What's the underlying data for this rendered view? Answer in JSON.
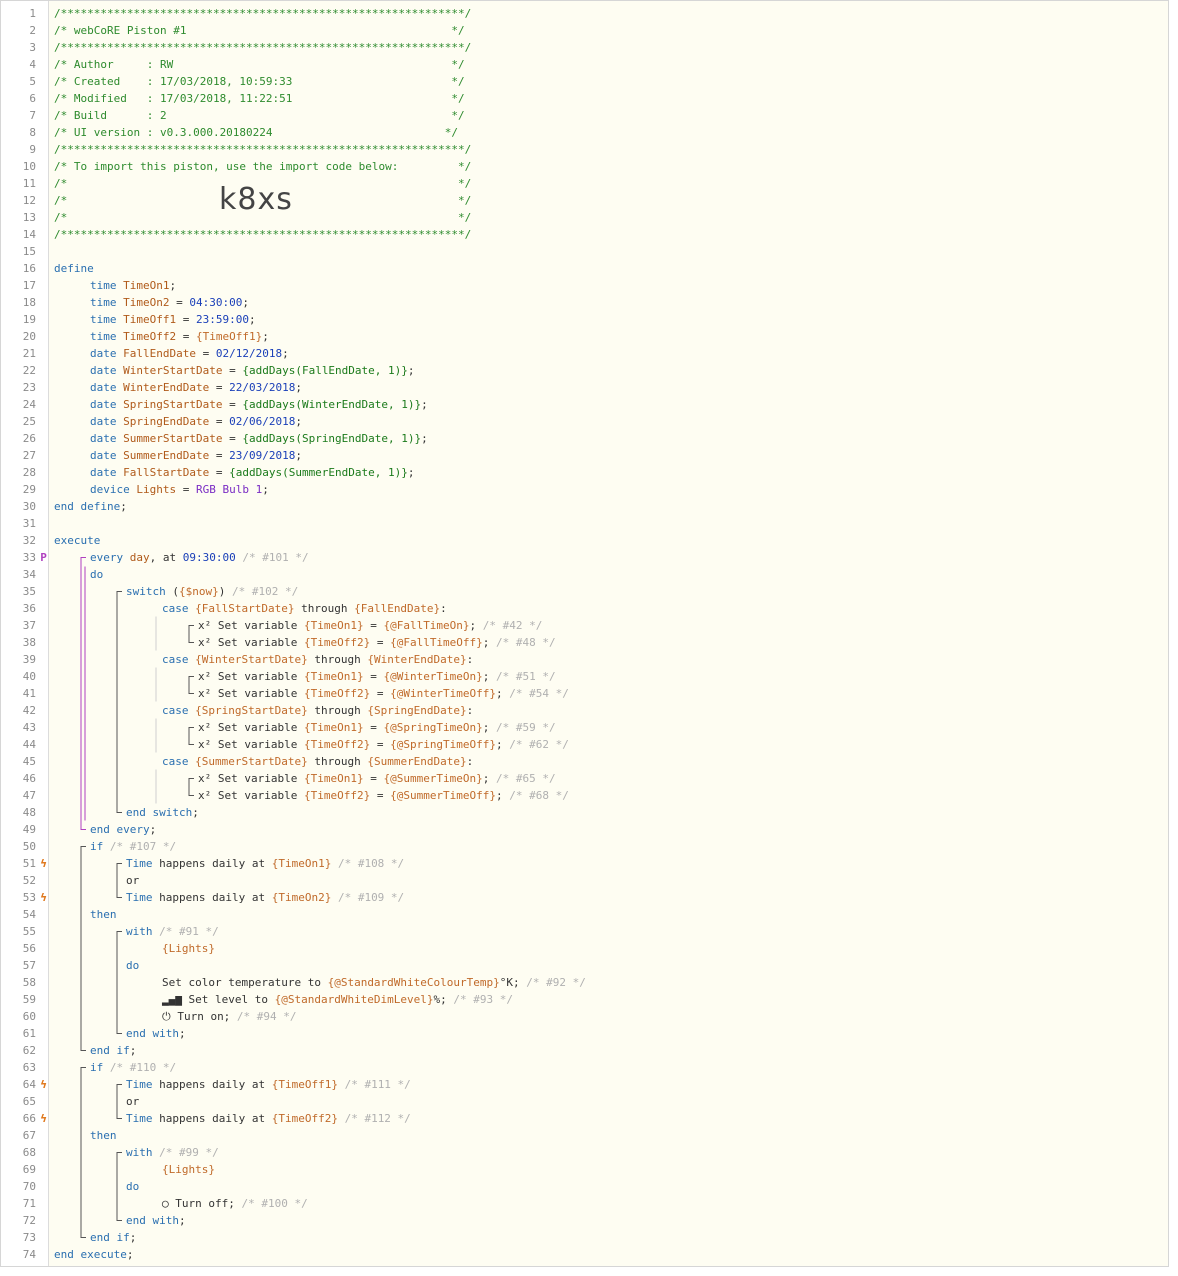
{
  "header": {
    "line_bar": "/*************************************************************/",
    "title_line": "/* webCoRE Piston #1                                        */",
    "author_line": "/* Author     : RW                                          */",
    "created_line": "/* Created    : 17/03/2018, 10:59:33                        */",
    "modified_line": "/* Modified   : 17/03/2018, 11:22:51                        */",
    "build_line": "/* Build      : 2                                           */",
    "ui_line": "/* UI version : v0.3.000.20180224                          */",
    "import_line": "/* To import this piston, use the import code below:         */",
    "blank_line": "/*                                                           */",
    "import_code": "k8xs"
  },
  "code_lines": [
    {
      "n": 1,
      "t": [
        [
          "c",
          "/*************************************************************/"
        ]
      ]
    },
    {
      "n": 2,
      "t": [
        [
          "c2",
          "/* webCoRE Piston #1                                        */"
        ]
      ]
    },
    {
      "n": 3,
      "t": [
        [
          "c",
          "/*************************************************************/"
        ]
      ]
    },
    {
      "n": 4,
      "t": [
        [
          "c2",
          "/* Author     : RW                                          */"
        ]
      ]
    },
    {
      "n": 5,
      "t": [
        [
          "c2",
          "/* Created    : 17/03/2018, 10:59:33                        */"
        ]
      ]
    },
    {
      "n": 6,
      "t": [
        [
          "c2",
          "/* Modified   : 17/03/2018, 11:22:51                        */"
        ]
      ]
    },
    {
      "n": 7,
      "t": [
        [
          "c2",
          "/* Build      : 2                                           */"
        ]
      ]
    },
    {
      "n": 8,
      "t": [
        [
          "c2",
          "/* UI version : v0.3.000.20180224                          */"
        ]
      ]
    },
    {
      "n": 9,
      "t": [
        [
          "c",
          "/*************************************************************/"
        ]
      ]
    },
    {
      "n": 10,
      "t": [
        [
          "c2",
          "/* To import this piston, use the import code below:         */"
        ]
      ]
    },
    {
      "n": 11,
      "t": [
        [
          "c2",
          "/*                                                           */"
        ]
      ]
    },
    {
      "n": 12,
      "t": [
        [
          "c2",
          "/*                                                           */"
        ]
      ],
      "big": true
    },
    {
      "n": 13,
      "t": [
        [
          "c2",
          "/*                                                           */"
        ]
      ]
    },
    {
      "n": 14,
      "t": [
        [
          "c",
          "/*************************************************************/"
        ]
      ]
    },
    {
      "n": 15,
      "t": []
    },
    {
      "n": 16,
      "t": [
        [
          "k",
          "define"
        ]
      ]
    },
    {
      "n": 17,
      "i": 1,
      "t": [
        [
          "ty",
          "time "
        ],
        [
          "nm",
          "TimeOn1"
        ],
        [
          "o",
          ";"
        ]
      ]
    },
    {
      "n": 18,
      "i": 1,
      "t": [
        [
          "ty",
          "time "
        ],
        [
          "nm",
          "TimeOn2"
        ],
        [
          "o",
          " = "
        ],
        [
          "n",
          "04:30:00"
        ],
        [
          "o",
          ";"
        ]
      ]
    },
    {
      "n": 19,
      "i": 1,
      "t": [
        [
          "ty",
          "time "
        ],
        [
          "nm",
          "TimeOff1"
        ],
        [
          "o",
          " = "
        ],
        [
          "n",
          "23:59:00"
        ],
        [
          "o",
          ";"
        ]
      ]
    },
    {
      "n": 20,
      "i": 1,
      "t": [
        [
          "ty",
          "time "
        ],
        [
          "nm",
          "TimeOff2"
        ],
        [
          "o",
          " = "
        ],
        [
          "v",
          "{TimeOff1}"
        ],
        [
          "o",
          ";"
        ]
      ]
    },
    {
      "n": 21,
      "i": 1,
      "t": [
        [
          "ty",
          "date "
        ],
        [
          "nm",
          "FallEndDate"
        ],
        [
          "o",
          " = "
        ],
        [
          "n",
          "02/12/2018"
        ],
        [
          "o",
          ";"
        ]
      ]
    },
    {
      "n": 22,
      "i": 1,
      "t": [
        [
          "ty",
          "date "
        ],
        [
          "nm",
          "WinterStartDate"
        ],
        [
          "o",
          " = "
        ],
        [
          "p",
          "{addDays(FallEndDate, 1)}"
        ],
        [
          "o",
          ";"
        ]
      ]
    },
    {
      "n": 23,
      "i": 1,
      "t": [
        [
          "ty",
          "date "
        ],
        [
          "nm",
          "WinterEndDate"
        ],
        [
          "o",
          " = "
        ],
        [
          "n",
          "22/03/2018"
        ],
        [
          "o",
          ";"
        ]
      ]
    },
    {
      "n": 24,
      "i": 1,
      "t": [
        [
          "ty",
          "date "
        ],
        [
          "nm",
          "SpringStartDate"
        ],
        [
          "o",
          " = "
        ],
        [
          "p",
          "{addDays(WinterEndDate, 1)}"
        ],
        [
          "o",
          ";"
        ]
      ]
    },
    {
      "n": 25,
      "i": 1,
      "t": [
        [
          "ty",
          "date "
        ],
        [
          "nm",
          "SpringEndDate"
        ],
        [
          "o",
          " = "
        ],
        [
          "n",
          "02/06/2018"
        ],
        [
          "o",
          ";"
        ]
      ]
    },
    {
      "n": 26,
      "i": 1,
      "t": [
        [
          "ty",
          "date "
        ],
        [
          "nm",
          "SummerStartDate"
        ],
        [
          "o",
          " = "
        ],
        [
          "p",
          "{addDays(SpringEndDate, 1)}"
        ],
        [
          "o",
          ";"
        ]
      ]
    },
    {
      "n": 27,
      "i": 1,
      "t": [
        [
          "ty",
          "date "
        ],
        [
          "nm",
          "SummerEndDate"
        ],
        [
          "o",
          " = "
        ],
        [
          "n",
          "23/09/2018"
        ],
        [
          "o",
          ";"
        ]
      ]
    },
    {
      "n": 28,
      "i": 1,
      "t": [
        [
          "ty",
          "date "
        ],
        [
          "nm",
          "FallStartDate"
        ],
        [
          "o",
          " = "
        ],
        [
          "p",
          "{addDays(SummerEndDate, 1)}"
        ],
        [
          "o",
          ";"
        ]
      ]
    },
    {
      "n": 29,
      "i": 1,
      "t": [
        [
          "ty",
          "device "
        ],
        [
          "nm",
          "Lights"
        ],
        [
          "o",
          " = "
        ],
        [
          "d",
          "RGB Bulb 1"
        ],
        [
          "o",
          ";"
        ]
      ]
    },
    {
      "n": 30,
      "t": [
        [
          "k",
          "end define"
        ],
        [
          "o",
          ";"
        ]
      ]
    },
    {
      "n": 31,
      "t": []
    },
    {
      "n": 32,
      "t": [
        [
          "k",
          "execute"
        ]
      ]
    },
    {
      "n": 33,
      "i": 1,
      "m": "p",
      "t": [
        [
          "k",
          "every "
        ],
        [
          "nm",
          "day"
        ],
        [
          "o",
          ", at "
        ],
        [
          "n",
          "09:30:00"
        ],
        [
          "cm",
          " /* #101 */"
        ]
      ]
    },
    {
      "n": 34,
      "i": 1,
      "t": [
        [
          "k",
          "do"
        ]
      ]
    },
    {
      "n": 35,
      "i": 2,
      "t": [
        [
          "k",
          "switch "
        ],
        [
          "o",
          "("
        ],
        [
          "v",
          "{$now}"
        ],
        [
          "o",
          ")"
        ],
        [
          "cm",
          " /* #102 */"
        ]
      ]
    },
    {
      "n": 36,
      "i": 3,
      "t": [
        [
          "k",
          "case "
        ],
        [
          "v",
          "{FallStartDate}"
        ],
        [
          "o",
          " through "
        ],
        [
          "v",
          "{FallEndDate}"
        ],
        [
          "o",
          ":"
        ]
      ]
    },
    {
      "n": 37,
      "i": 4,
      "t": [
        [
          "i",
          "x² "
        ],
        [
          "o",
          "Set variable "
        ],
        [
          "v",
          "{TimeOn1}"
        ],
        [
          "o",
          " = "
        ],
        [
          "v",
          "{@FallTimeOn}"
        ],
        [
          "o",
          ";"
        ],
        [
          "cm",
          " /* #42 */"
        ]
      ]
    },
    {
      "n": 38,
      "i": 4,
      "t": [
        [
          "i",
          "x² "
        ],
        [
          "o",
          "Set variable "
        ],
        [
          "v",
          "{TimeOff2}"
        ],
        [
          "o",
          " = "
        ],
        [
          "v",
          "{@FallTimeOff}"
        ],
        [
          "o",
          ";"
        ],
        [
          "cm",
          " /* #48 */"
        ]
      ]
    },
    {
      "n": 39,
      "i": 3,
      "t": [
        [
          "k",
          "case "
        ],
        [
          "v",
          "{WinterStartDate}"
        ],
        [
          "o",
          " through "
        ],
        [
          "v",
          "{WinterEndDate}"
        ],
        [
          "o",
          ":"
        ]
      ]
    },
    {
      "n": 40,
      "i": 4,
      "t": [
        [
          "i",
          "x² "
        ],
        [
          "o",
          "Set variable "
        ],
        [
          "v",
          "{TimeOn1}"
        ],
        [
          "o",
          " = "
        ],
        [
          "v",
          "{@WinterTimeOn}"
        ],
        [
          "o",
          ";"
        ],
        [
          "cm",
          " /* #51 */"
        ]
      ]
    },
    {
      "n": 41,
      "i": 4,
      "t": [
        [
          "i",
          "x² "
        ],
        [
          "o",
          "Set variable "
        ],
        [
          "v",
          "{TimeOff2}"
        ],
        [
          "o",
          " = "
        ],
        [
          "v",
          "{@WinterTimeOff}"
        ],
        [
          "o",
          ";"
        ],
        [
          "cm",
          " /* #54 */"
        ]
      ]
    },
    {
      "n": 42,
      "i": 3,
      "t": [
        [
          "k",
          "case "
        ],
        [
          "v",
          "{SpringStartDate}"
        ],
        [
          "o",
          " through "
        ],
        [
          "v",
          "{SpringEndDate}"
        ],
        [
          "o",
          ":"
        ]
      ]
    },
    {
      "n": 43,
      "i": 4,
      "t": [
        [
          "i",
          "x² "
        ],
        [
          "o",
          "Set variable "
        ],
        [
          "v",
          "{TimeOn1}"
        ],
        [
          "o",
          " = "
        ],
        [
          "v",
          "{@SpringTimeOn}"
        ],
        [
          "o",
          ";"
        ],
        [
          "cm",
          " /* #59 */"
        ]
      ]
    },
    {
      "n": 44,
      "i": 4,
      "t": [
        [
          "i",
          "x² "
        ],
        [
          "o",
          "Set variable "
        ],
        [
          "v",
          "{TimeOff2}"
        ],
        [
          "o",
          " = "
        ],
        [
          "v",
          "{@SpringTimeOff}"
        ],
        [
          "o",
          ";"
        ],
        [
          "cm",
          " /* #62 */"
        ]
      ]
    },
    {
      "n": 45,
      "i": 3,
      "t": [
        [
          "k",
          "case "
        ],
        [
          "v",
          "{SummerStartDate}"
        ],
        [
          "o",
          " through "
        ],
        [
          "v",
          "{SummerEndDate}"
        ],
        [
          "o",
          ":"
        ]
      ]
    },
    {
      "n": 46,
      "i": 4,
      "t": [
        [
          "i",
          "x² "
        ],
        [
          "o",
          "Set variable "
        ],
        [
          "v",
          "{TimeOn1}"
        ],
        [
          "o",
          " = "
        ],
        [
          "v",
          "{@SummerTimeOn}"
        ],
        [
          "o",
          ";"
        ],
        [
          "cm",
          " /* #65 */"
        ]
      ]
    },
    {
      "n": 47,
      "i": 4,
      "t": [
        [
          "i",
          "x² "
        ],
        [
          "o",
          "Set variable "
        ],
        [
          "v",
          "{TimeOff2}"
        ],
        [
          "o",
          " = "
        ],
        [
          "v",
          "{@SummerTimeOff}"
        ],
        [
          "o",
          ";"
        ],
        [
          "cm",
          " /* #68 */"
        ]
      ]
    },
    {
      "n": 48,
      "i": 2,
      "t": [
        [
          "k",
          "end switch"
        ],
        [
          "o",
          ";"
        ]
      ]
    },
    {
      "n": 49,
      "i": 1,
      "t": [
        [
          "k",
          "end every"
        ],
        [
          "o",
          ";"
        ]
      ]
    },
    {
      "n": 50,
      "i": 1,
      "t": [
        [
          "k",
          "if"
        ],
        [
          "cm",
          " /* #107 */"
        ]
      ]
    },
    {
      "n": 51,
      "i": 2,
      "m": "bolt",
      "t": [
        [
          "ty",
          "Time"
        ],
        [
          "o",
          " happens daily at "
        ],
        [
          "v",
          "{TimeOn1}"
        ],
        [
          "cm",
          " /* #108 */"
        ]
      ]
    },
    {
      "n": 52,
      "i": 2,
      "t": [
        [
          "o",
          "or"
        ]
      ]
    },
    {
      "n": 53,
      "i": 2,
      "m": "bolt",
      "t": [
        [
          "ty",
          "Time"
        ],
        [
          "o",
          " happens daily at "
        ],
        [
          "v",
          "{TimeOn2}"
        ],
        [
          "cm",
          " /* #109 */"
        ]
      ]
    },
    {
      "n": 54,
      "i": 1,
      "t": [
        [
          "k",
          "then"
        ]
      ]
    },
    {
      "n": 55,
      "i": 2,
      "t": [
        [
          "k",
          "with"
        ],
        [
          "cm",
          " /* #91 */"
        ]
      ]
    },
    {
      "n": 56,
      "i": 3,
      "t": [
        [
          "v",
          "{Lights}"
        ]
      ]
    },
    {
      "n": 57,
      "i": 2,
      "t": [
        [
          "k",
          "do"
        ]
      ]
    },
    {
      "n": 58,
      "i": 3,
      "t": [
        [
          "o",
          "Set color temperature to "
        ],
        [
          "v",
          "{@StandardWhiteColourTemp}"
        ],
        [
          "o",
          "°K;"
        ],
        [
          "cm",
          " /* #92 */"
        ]
      ]
    },
    {
      "n": 59,
      "i": 3,
      "t": [
        [
          "i",
          "▂▄▆ "
        ],
        [
          "o",
          "Set level to "
        ],
        [
          "v",
          "{@StandardWhiteDimLevel}"
        ],
        [
          "o",
          "%;"
        ],
        [
          "cm",
          " /* #93 */"
        ]
      ]
    },
    {
      "n": 60,
      "i": 3,
      "t": [
        [
          "i",
          "⏻ "
        ],
        [
          "o",
          "Turn on;"
        ],
        [
          "cm",
          " /* #94 */"
        ]
      ]
    },
    {
      "n": 61,
      "i": 2,
      "t": [
        [
          "k",
          "end with"
        ],
        [
          "o",
          ";"
        ]
      ]
    },
    {
      "n": 62,
      "i": 1,
      "t": [
        [
          "k",
          "end if"
        ],
        [
          "o",
          ";"
        ]
      ]
    },
    {
      "n": 63,
      "i": 1,
      "t": [
        [
          "k",
          "if"
        ],
        [
          "cm",
          " /* #110 */"
        ]
      ]
    },
    {
      "n": 64,
      "i": 2,
      "m": "bolt",
      "t": [
        [
          "ty",
          "Time"
        ],
        [
          "o",
          " happens daily at "
        ],
        [
          "v",
          "{TimeOff1}"
        ],
        [
          "cm",
          " /* #111 */"
        ]
      ]
    },
    {
      "n": 65,
      "i": 2,
      "t": [
        [
          "o",
          "or"
        ]
      ]
    },
    {
      "n": 66,
      "i": 2,
      "m": "bolt",
      "t": [
        [
          "ty",
          "Time"
        ],
        [
          "o",
          " happens daily at "
        ],
        [
          "v",
          "{TimeOff2}"
        ],
        [
          "cm",
          " /* #112 */"
        ]
      ]
    },
    {
      "n": 67,
      "i": 1,
      "t": [
        [
          "k",
          "then"
        ]
      ]
    },
    {
      "n": 68,
      "i": 2,
      "t": [
        [
          "k",
          "with"
        ],
        [
          "cm",
          " /* #99 */"
        ]
      ]
    },
    {
      "n": 69,
      "i": 3,
      "t": [
        [
          "v",
          "{Lights}"
        ]
      ]
    },
    {
      "n": 70,
      "i": 2,
      "t": [
        [
          "k",
          "do"
        ]
      ]
    },
    {
      "n": 71,
      "i": 3,
      "t": [
        [
          "i",
          "◯ "
        ],
        [
          "o",
          "Turn off;"
        ],
        [
          "cm",
          " /* #100 */"
        ]
      ]
    },
    {
      "n": 72,
      "i": 2,
      "t": [
        [
          "k",
          "end with"
        ],
        [
          "o",
          ";"
        ]
      ]
    },
    {
      "n": 73,
      "i": 1,
      "t": [
        [
          "k",
          "end if"
        ],
        [
          "o",
          ";"
        ]
      ]
    },
    {
      "n": 74,
      "t": [
        [
          "k",
          "end execute"
        ],
        [
          "o",
          ";"
        ]
      ]
    }
  ],
  "markers": {
    "p": "P",
    "bolt": "ϟ"
  },
  "colors": {
    "background": "#fefdf2",
    "keyword": "#2a6fb0",
    "variable": "#c06a2a",
    "number": "#1a3fb8",
    "device": "#7a2cc4",
    "comment": "#b0b0b0",
    "header_comment": "#2e8b2e",
    "bracket_line": "#b040c0"
  }
}
